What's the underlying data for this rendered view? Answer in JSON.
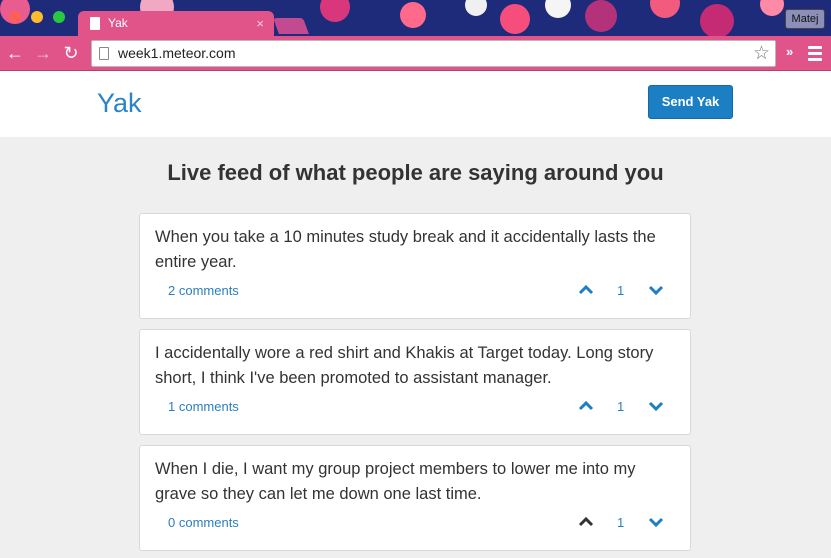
{
  "browser": {
    "tab_title": "Yak",
    "tab_close": "×",
    "profile_name": "Matej",
    "url": "week1.meteor.com",
    "back_glyph": "←",
    "forward_glyph": "→",
    "reload_glyph": "↻",
    "star_glyph": "☆",
    "extensions_glyph": "»",
    "icons": [
      "back-icon",
      "forward-icon",
      "reload-icon",
      "page-icon",
      "star-icon",
      "menu-icon"
    ],
    "theme_colors": {
      "tabstrip": "#1e2a7a",
      "toolbar": "#e0548a"
    }
  },
  "app": {
    "brand": "Yak",
    "send_button": "Send Yak",
    "feed_title": "Live feed of what people are saying around you",
    "accent_color": "#2a84c5",
    "posts": [
      {
        "text": "When you take a 10 minutes study break and it accidentally lasts the entire year.",
        "comments": "2 comments",
        "votes": "1",
        "up_active": true
      },
      {
        "text": "I accidentally wore a red shirt and Khakis at Target today. Long story short, I think I've been promoted to assistant manager.",
        "comments": "1 comments",
        "votes": "1",
        "up_active": true
      },
      {
        "text": "When I die, I want my group project members to lower me into my grave so they can let me down one last time.",
        "comments": "0 comments",
        "votes": "1",
        "up_active": false
      }
    ]
  }
}
